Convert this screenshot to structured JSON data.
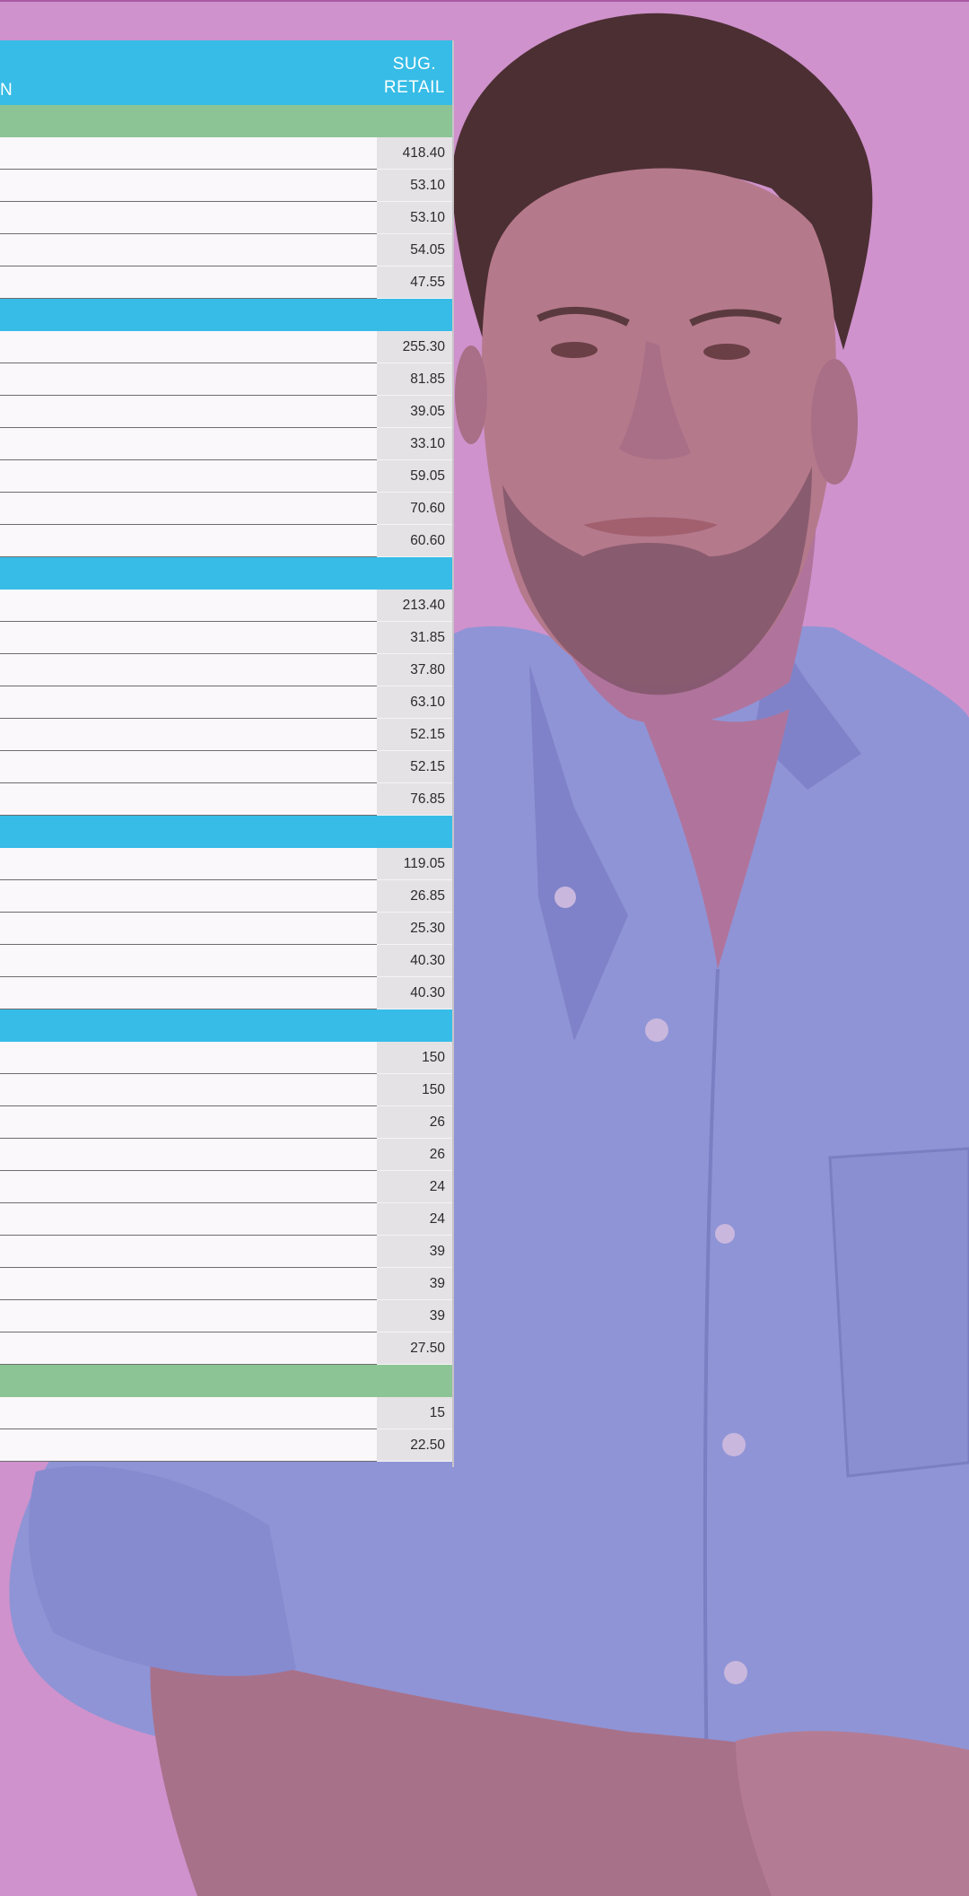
{
  "table": {
    "header": {
      "left_fragment": "N",
      "right_line1": "SUG.",
      "right_line2": "RETAIL"
    },
    "sections": [
      {
        "color": "#8cc496",
        "prices": [
          "418.40",
          "53.10",
          "53.10",
          "54.05",
          "47.55"
        ]
      },
      {
        "color": "#36bce6",
        "prices": [
          "255.30",
          "81.85",
          "39.05",
          "33.10",
          "59.05",
          "70.60",
          "60.60"
        ]
      },
      {
        "color": "#36bce6",
        "prices": [
          "213.40",
          "31.85",
          "37.80",
          "63.10",
          "52.15",
          "52.15",
          "76.85"
        ]
      },
      {
        "color": "#36bce6",
        "prices": [
          "119.05",
          "26.85",
          "25.30",
          "40.30",
          "40.30"
        ]
      },
      {
        "color": "#36bce6",
        "prices": [
          "150",
          "150",
          "26",
          "26",
          "24",
          "24",
          "39",
          "39",
          "39",
          "27.50"
        ]
      },
      {
        "color": "#8cc496",
        "prices": [
          "15",
          "22.50"
        ]
      }
    ]
  },
  "colors": {
    "background": "#cf92cc",
    "header": "#36bce6",
    "section_green": "#8cc496",
    "shirt": "#8f94d6"
  },
  "icons": {
    "photo": "man-in-blue-shirt-photo"
  }
}
